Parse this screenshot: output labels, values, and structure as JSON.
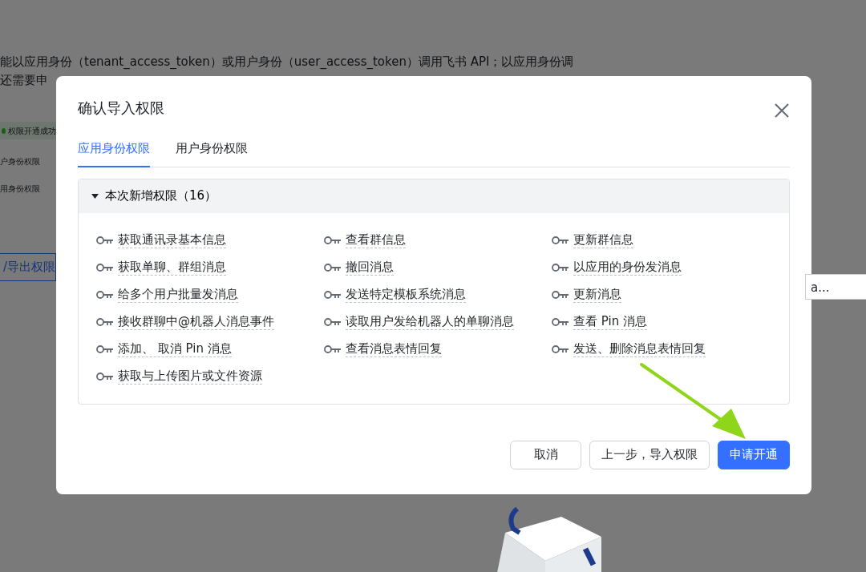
{
  "background": {
    "intro_lines": [
      "能以应用身份（tenant_access_token）或用户身份（user_access_token）调用飞书 API；以应用身份调",
      "还需要申"
    ],
    "notices": [
      {
        "kind": "success",
        "text": "权限开通成功"
      },
      {
        "kind": "plain",
        "text": "户身份权限"
      },
      {
        "kind": "plain",
        "text": "用身份权限"
      }
    ],
    "export_button": "/导出权限",
    "cell_text": "a..."
  },
  "dialog": {
    "title": "确认导入权限",
    "tabs": [
      {
        "label": "应用身份权限",
        "selected": true
      },
      {
        "label": "用户身份权限",
        "selected": false
      }
    ],
    "section": {
      "title": "本次新增权限（16）",
      "expanded": true,
      "permissions": [
        "获取通讯录基本信息",
        "查看群信息",
        "更新群信息",
        "获取单聊、群组消息",
        "撤回消息",
        "以应用的身份发消息",
        "给多个用户批量发消息",
        "发送特定模板系统消息",
        "更新消息",
        "接收群聊中@机器人消息事件",
        "读取用户发给机器人的单聊消息",
        "查看 Pin 消息",
        "添加、 取消 Pin 消息",
        "查看消息表情回复",
        "发送、删除消息表情回复",
        "获取与上传图片或文件资源"
      ]
    },
    "buttons": [
      {
        "label": "取消",
        "kind": "default"
      },
      {
        "label": "上一步，导入权限",
        "kind": "default"
      },
      {
        "label": "申请开通",
        "kind": "primary"
      }
    ]
  }
}
